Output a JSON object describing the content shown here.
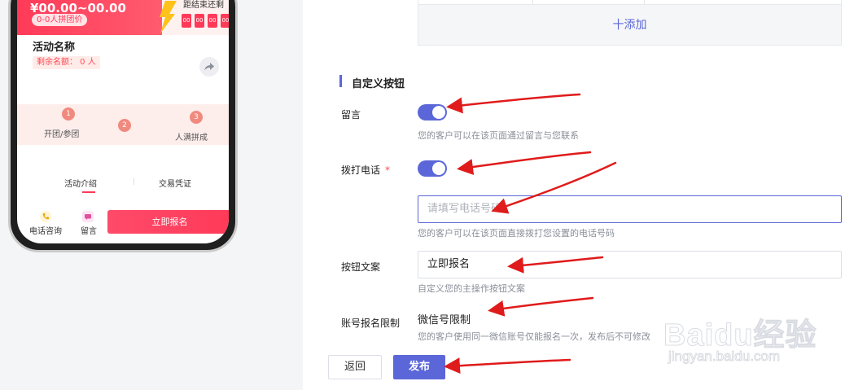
{
  "phone": {
    "price": "¥00.00~00.00",
    "group_tag": "0-0人拼团价",
    "countdown_label": "距结束还剩",
    "countdown": [
      "00",
      "00",
      "00",
      "00"
    ],
    "activity_name": "活动名称",
    "remaining": "剩余名额： 0 人",
    "steps": [
      {
        "num": "1",
        "label": "开团/参团"
      },
      {
        "num": "2",
        "label": ""
      },
      {
        "num": "3",
        "label": "人满拼成"
      }
    ],
    "tabs": [
      "活动介绍",
      "交易凭证"
    ],
    "bottom_actions": [
      {
        "label": "电话咨询",
        "icon": "phone-icon"
      },
      {
        "label": "留言",
        "icon": "message-icon"
      }
    ],
    "signup_button": "立即报名"
  },
  "form": {
    "add_label": "十添加",
    "section_title": "自定义按钮",
    "message": {
      "label": "留言",
      "enabled": true,
      "hint": "您的客户可以在该页面通过留言与您联系"
    },
    "phone_call": {
      "label": "拨打电话",
      "required_mark": "*",
      "enabled": true,
      "placeholder": "请填写电话号码",
      "hint": "您的客户可以在该页面直接拨打您设置的电话号码"
    },
    "button_text": {
      "label": "按钮文案",
      "value": "立即报名",
      "hint": "自定义您的主操作按钮文案"
    },
    "account_limit": {
      "label": "账号报名限制",
      "value": "微信号限制",
      "hint": "您的客户使用同一微信账号仅能报名一次，发布后不可修改"
    },
    "back_button": "返回",
    "publish_button": "发布"
  },
  "watermark": {
    "main": "Baidu经验",
    "sub": "jingyan.baidu.com"
  },
  "colors": {
    "accent": "#5b67d8",
    "brand_red": "#ff3a58",
    "arrow": "#e01b1b"
  }
}
